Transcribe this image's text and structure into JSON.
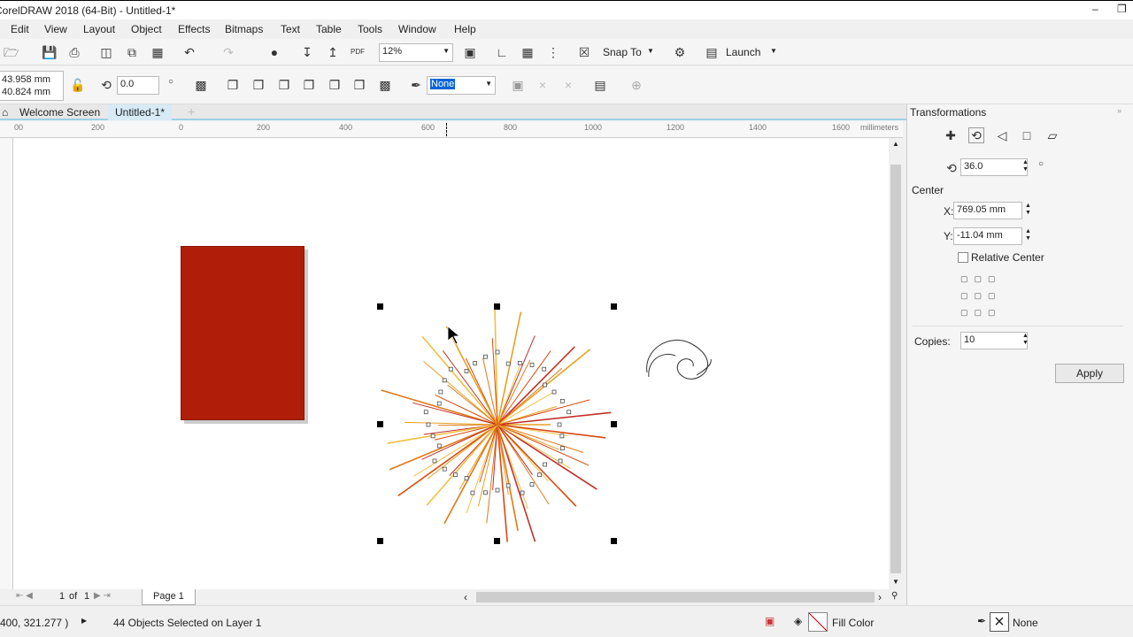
{
  "window": {
    "title": "CorelDRAW 2018 (64-Bit) - Untitled-1*"
  },
  "menu": [
    "Edit",
    "View",
    "Layout",
    "Object",
    "Effects",
    "Bitmaps",
    "Text",
    "Table",
    "Tools",
    "Window",
    "Help"
  ],
  "toolbar": {
    "zoom": "12%",
    "snap_to": "Snap To",
    "launch": "Launch"
  },
  "propbar": {
    "width": "43.958 mm",
    "height": "40.824 mm",
    "rotation": "0.0",
    "outline": "None"
  },
  "tabs": {
    "welcome": "Welcome Screen",
    "document": "Untitled-1*"
  },
  "ruler": {
    "ticks": [
      "00",
      "200",
      "0",
      "200",
      "400",
      "600",
      "800",
      "1000",
      "1200",
      "1400",
      "1600"
    ],
    "unit": "millimeters"
  },
  "pages": {
    "current": "1",
    "of": "of",
    "total": "1",
    "tab": "Page 1"
  },
  "status": {
    "coords": "400, 321.277 )",
    "selection": "44 Objects Selected on Layer 1",
    "fill": "Fill Color",
    "outline": "None"
  },
  "docker": {
    "title": "Transformations",
    "angle": "36.0",
    "center_label": "Center",
    "x_label": "X:",
    "x": "769.05 mm",
    "y_label": "Y:",
    "y": "-11.04 mm",
    "relative_center": "Relative Center",
    "copies_label": "Copies:",
    "copies": "10",
    "apply": "Apply"
  },
  "colors": {
    "rect": "#b01e0a",
    "accent": "#9fd0e6"
  }
}
